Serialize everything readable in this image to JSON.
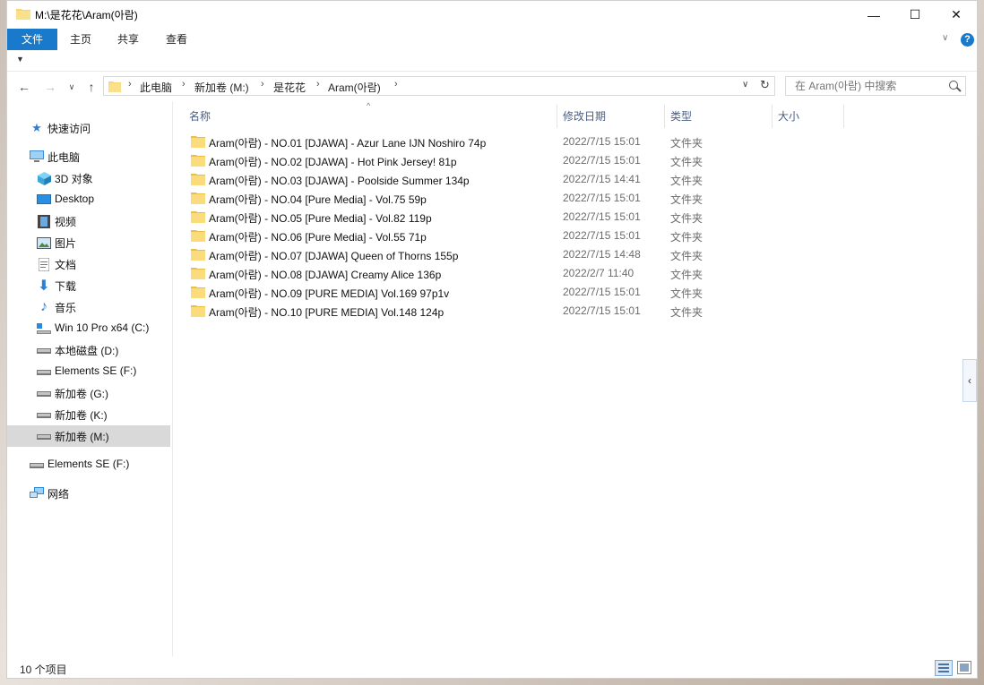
{
  "window": {
    "title": "M:\\是花花\\Aram(아람)",
    "controls": {
      "minimize": "—",
      "maximize": "☐",
      "close": "✕"
    }
  },
  "ribbon": {
    "tabs": [
      {
        "label": "文件",
        "active": true
      },
      {
        "label": "主页",
        "active": false
      },
      {
        "label": "共享",
        "active": false
      },
      {
        "label": "查看",
        "active": false
      }
    ],
    "help": "?"
  },
  "address_bar": {
    "crumbs": [
      "此电脑",
      "新加卷 (M:)",
      "是花花",
      "Aram(아람)"
    ]
  },
  "search": {
    "placeholder": "在 Aram(아람) 中搜索"
  },
  "sidebar": {
    "items": [
      {
        "label": "快速访问",
        "icon": "star-icon"
      },
      {
        "label": "此电脑",
        "icon": "computer-icon"
      },
      {
        "label": "3D 对象",
        "icon": "cube-icon"
      },
      {
        "label": "Desktop",
        "icon": "desktop-icon"
      },
      {
        "label": "视频",
        "icon": "video-icon"
      },
      {
        "label": "图片",
        "icon": "pictures-icon"
      },
      {
        "label": "文档",
        "icon": "document-icon"
      },
      {
        "label": "下载",
        "icon": "download-icon"
      },
      {
        "label": "音乐",
        "icon": "music-icon"
      },
      {
        "label": "Win 10 Pro x64 (C:)",
        "icon": "system-drive-icon"
      },
      {
        "label": "本地磁盘 (D:)",
        "icon": "drive-icon"
      },
      {
        "label": "Elements SE (F:)",
        "icon": "drive-icon"
      },
      {
        "label": "新加卷 (G:)",
        "icon": "drive-icon"
      },
      {
        "label": "新加卷 (K:)",
        "icon": "drive-icon"
      },
      {
        "label": "新加卷 (M:)",
        "icon": "drive-icon",
        "selected": true
      },
      {
        "label": "Elements SE (F:)",
        "icon": "drive-icon"
      },
      {
        "label": "网络",
        "icon": "network-icon"
      }
    ]
  },
  "columns": {
    "name": "名称",
    "date": "修改日期",
    "type": "类型",
    "size": "大小"
  },
  "files": [
    {
      "name": "Aram(아람) - NO.01 [DJAWA] - Azur Lane IJN Noshiro 74p",
      "date": "2022/7/15 15:01",
      "type": "文件夹"
    },
    {
      "name": "Aram(아람) - NO.02 [DJAWA] - Hot Pink Jersey! 81p",
      "date": "2022/7/15 15:01",
      "type": "文件夹"
    },
    {
      "name": "Aram(아람) - NO.03 [DJAWA] - Poolside Summer 134p",
      "date": "2022/7/15 14:41",
      "type": "文件夹"
    },
    {
      "name": "Aram(아람) - NO.04 [Pure Media] - Vol.75 59p",
      "date": "2022/7/15 15:01",
      "type": "文件夹"
    },
    {
      "name": "Aram(아람) - NO.05 [Pure Media] - Vol.82 119p",
      "date": "2022/7/15 15:01",
      "type": "文件夹"
    },
    {
      "name": "Aram(아람) - NO.06 [Pure Media] - Vol.55 71p",
      "date": "2022/7/15 15:01",
      "type": "文件夹"
    },
    {
      "name": "Aram(아람) - NO.07 [DJAWA] Queen of Thorns 155p",
      "date": "2022/7/15 14:48",
      "type": "文件夹"
    },
    {
      "name": "Aram(아람) - NO.08 [DJAWA] Creamy Alice 136p",
      "date": "2022/2/7 11:40",
      "type": "文件夹"
    },
    {
      "name": "Aram(아람) - NO.09 [PURE MEDIA] Vol.169 97p1v",
      "date": "2022/7/15 15:01",
      "type": "文件夹"
    },
    {
      "name": "Aram(아람) - NO.10 [PURE MEDIA] Vol.148 124p",
      "date": "2022/7/15 15:01",
      "type": "文件夹"
    }
  ],
  "status": {
    "count": "10 个项目"
  },
  "colors": {
    "accent": "#1979ca",
    "folder": "#f7d573",
    "selection": "#d9d9d9",
    "header_text": "#4b5f82"
  }
}
